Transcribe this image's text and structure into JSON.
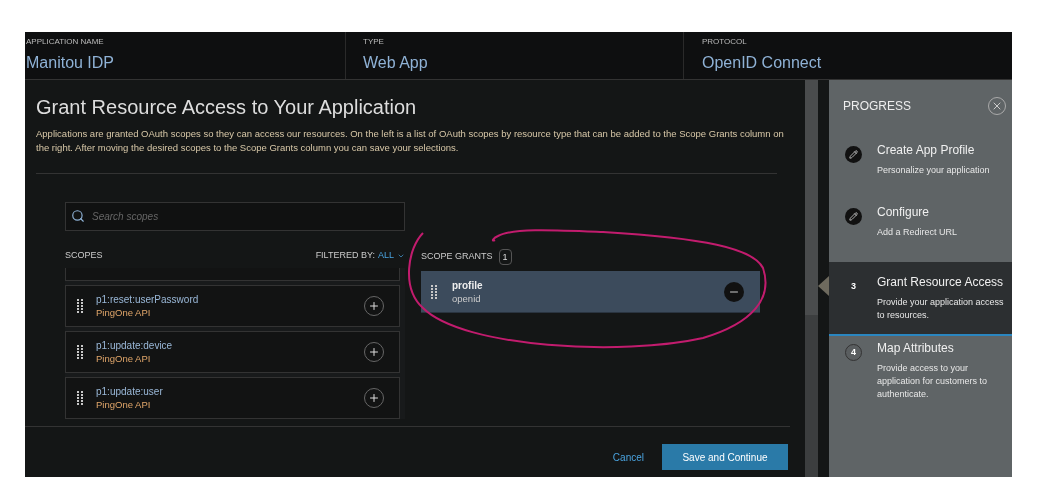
{
  "header": [
    {
      "label": "APPLICATION NAME",
      "value": "Manitou IDP"
    },
    {
      "label": "TYPE",
      "value": "Web App"
    },
    {
      "label": "PROTOCOL",
      "value": "OpenID Connect"
    }
  ],
  "title": "Grant Resource Access to Your Application",
  "description": "Applications are granted OAuth scopes so they can access our resources. On the left is a list of OAuth scopes by resource type that can be added to the Scope Grants column on the right. After moving the desired scopes to the Scope Grants column you can save your selections.",
  "search": {
    "placeholder": "Search scopes"
  },
  "scopes": {
    "label": "SCOPES",
    "filter_label": "FILTERED BY:",
    "filter_value": "ALL",
    "items": [
      {
        "name": "p1:reset:userPassword",
        "resource": "PingOne API"
      },
      {
        "name": "p1:update:device",
        "resource": "PingOne API"
      },
      {
        "name": "p1:update:user",
        "resource": "PingOne API"
      }
    ]
  },
  "grants": {
    "label": "SCOPE GRANTS",
    "count": "1",
    "items": [
      {
        "name": "profile",
        "resource": "openid"
      }
    ]
  },
  "buttons": {
    "cancel": "Cancel",
    "save": "Save and Continue"
  },
  "progress": {
    "title": "PROGRESS",
    "steps": [
      {
        "kind": "done",
        "title": "Create App Profile",
        "subtitle": "Personalize your application",
        "selected": false
      },
      {
        "kind": "done",
        "title": "Configure",
        "subtitle": "Add a Redirect URL",
        "selected": false
      },
      {
        "kind": "number",
        "number": "3",
        "title": "Grant Resource Access",
        "subtitle": "Provide your application access to resources.",
        "selected": true
      },
      {
        "kind": "number",
        "number": "4",
        "title": "Map Attributes",
        "subtitle": "Provide access to your application for customers to authenticate.",
        "selected": false
      }
    ]
  }
}
